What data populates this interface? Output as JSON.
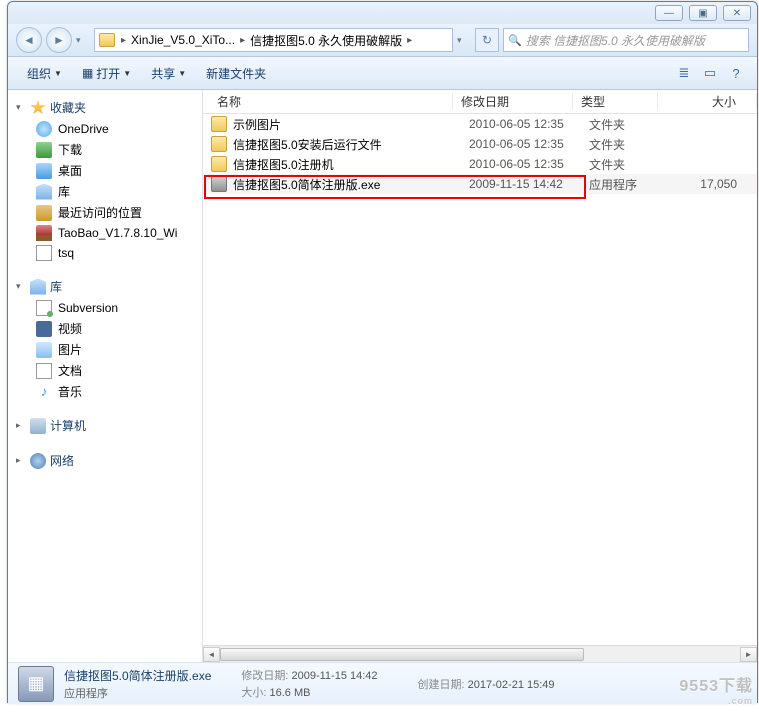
{
  "window_controls": {
    "min": "—",
    "max": "▣",
    "close": "✕"
  },
  "nav": {
    "back": "◄",
    "forward": "►"
  },
  "breadcrumb": {
    "segments": [
      "XinJie_V5.0_XiTo...",
      "信捷抠图5.0 永久使用破解版"
    ]
  },
  "refresh_icon": "↻",
  "down_icon": "▾",
  "search": {
    "placeholder": "搜索 信捷抠图5.0 永久使用破解版",
    "icon": "🔍"
  },
  "toolbar": {
    "organize": "组织",
    "open": "打开",
    "open_icon": "▦",
    "share": "共享",
    "newfolder": "新建文件夹",
    "view_icon": "≣",
    "preview_icon": "▭",
    "help_icon": "?"
  },
  "sidebar": {
    "favorites": "收藏夹",
    "items_fav": [
      {
        "label": "OneDrive",
        "icon": "ico-cloud"
      },
      {
        "label": "下载",
        "icon": "ico-dl"
      },
      {
        "label": "桌面",
        "icon": "ico-desktop"
      },
      {
        "label": "库",
        "icon": "ico-lib"
      },
      {
        "label": "最近访问的位置",
        "icon": "ico-recent"
      },
      {
        "label": "TaoBao_V1.7.8.10_Wi",
        "icon": "ico-rar"
      },
      {
        "label": "tsq",
        "icon": "ico-txt"
      }
    ],
    "libraries": "库",
    "items_lib": [
      {
        "label": "Subversion",
        "icon": "ico-svn"
      },
      {
        "label": "视频",
        "icon": "ico-video"
      },
      {
        "label": "图片",
        "icon": "ico-pic"
      },
      {
        "label": "文档",
        "icon": "ico-doc"
      },
      {
        "label": "音乐",
        "icon": "ico-music",
        "glyph": "♪"
      }
    ],
    "computer": "计算机",
    "network": "网络"
  },
  "columns": {
    "name": "名称",
    "date": "修改日期",
    "type": "类型",
    "size": "大小"
  },
  "files": [
    {
      "name": "示例图片",
      "date": "2010-06-05 12:35",
      "type": "文件夹",
      "size": "",
      "icon": "ico-folder"
    },
    {
      "name": "信捷抠图5.0安装后运行文件",
      "date": "2010-06-05 12:35",
      "type": "文件夹",
      "size": "",
      "icon": "ico-folder"
    },
    {
      "name": "信捷抠图5.0注册机",
      "date": "2010-06-05 12:35",
      "type": "文件夹",
      "size": "",
      "icon": "ico-folder"
    },
    {
      "name": "信捷抠图5.0简体注册版.exe",
      "date": "2009-11-15 14:42",
      "type": "应用程序",
      "size": "17,050",
      "icon": "ico-exe",
      "selected": true
    }
  ],
  "details": {
    "name": "信捷抠图5.0简体注册版.exe",
    "type": "应用程序",
    "mod_label": "修改日期:",
    "mod_value": "2009-11-15 14:42",
    "size_label": "大小:",
    "size_value": "16.6 MB",
    "created_label": "创建日期:",
    "created_value": "2017-02-21 15:49"
  },
  "watermark": {
    "main": "9553下载",
    "sub": ".com"
  }
}
